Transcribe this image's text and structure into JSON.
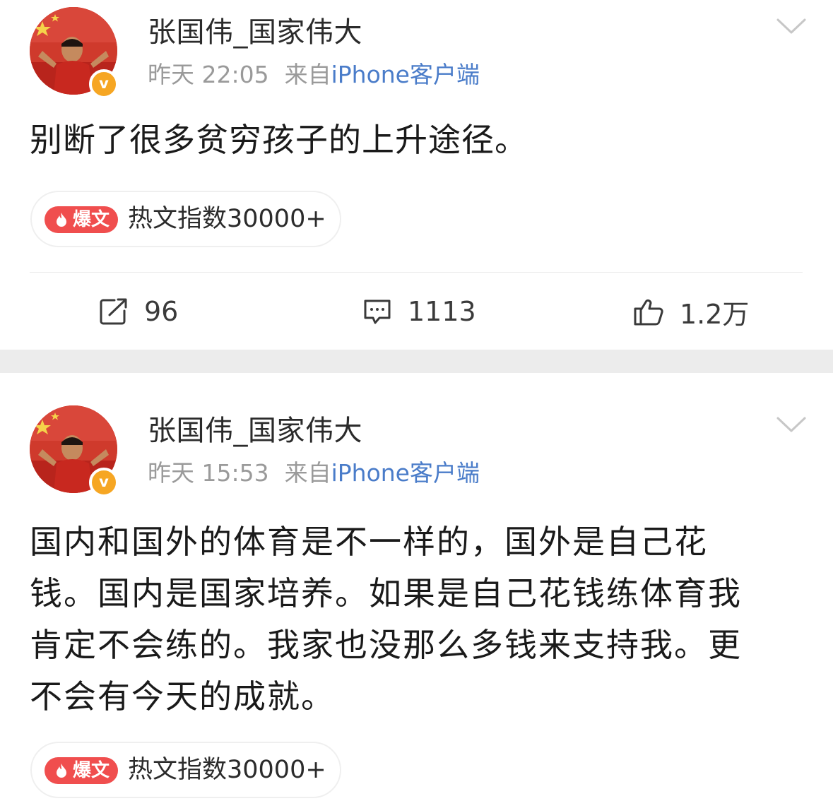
{
  "colors": {
    "background": "#ffffff",
    "separator": "#ececec",
    "meta_text": "#9a9a9a",
    "source_link": "#4a7cc9",
    "hot_tag": "#f04e4e",
    "verified_badge": "#f6a623"
  },
  "posts": [
    {
      "username": "张国伟_国家伟大",
      "time": "昨天 22:05",
      "source_prefix": "来自",
      "source_app": "iPhone客户端",
      "text": "别断了很多贫穷孩子的上升途径。",
      "hot_tag_label": "爆文",
      "hot_index": "热文指数30000+",
      "reposts": "96",
      "comments": "1113",
      "likes": "1.2万",
      "icons": {
        "avatar": "avatar-photo",
        "verified": "verified-v-icon",
        "menu": "chevron-down-icon",
        "repost": "repost-icon",
        "comment": "comment-icon",
        "like": "thumbs-up-icon",
        "hot": "flame-icon"
      }
    },
    {
      "username": "张国伟_国家伟大",
      "time": "昨天 15:53",
      "source_prefix": "来自",
      "source_app": "iPhone客户端",
      "text_lines": [
        "国内和国外的体育是不一样的，国外是自己花",
        "钱。国内是国家培养。如果是自己花钱练体育我",
        "肯定不会练的。我家也没那么多钱来支持我。更",
        "不会有今天的成就。"
      ],
      "hot_tag_label": "爆文",
      "hot_index": "热文指数30000+"
    }
  ]
}
